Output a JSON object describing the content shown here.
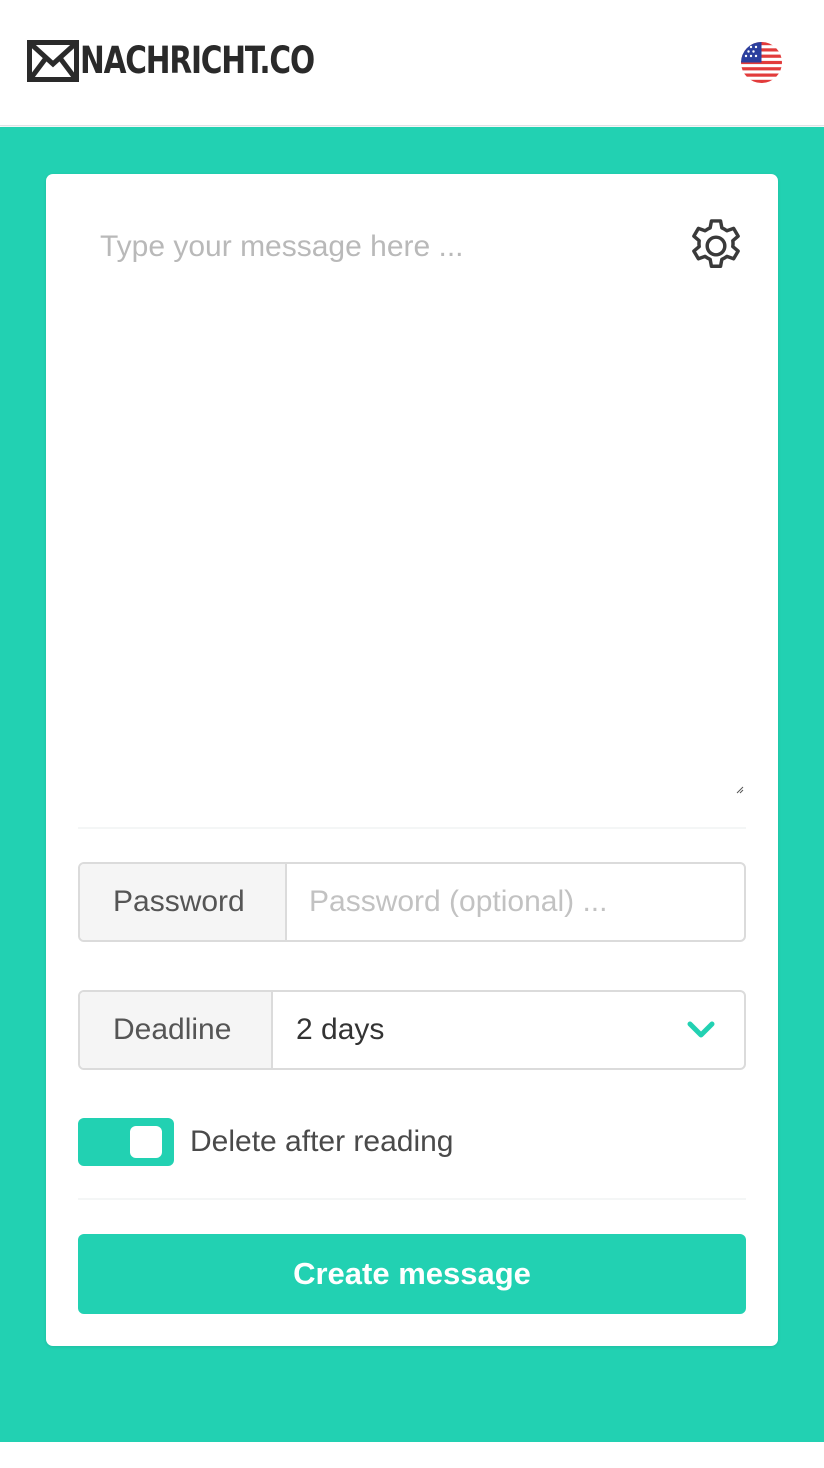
{
  "header": {
    "logo_text": "NACHRICHT.CO",
    "logo_icon": "envelope-icon",
    "language_icon": "us-flag-icon"
  },
  "composer": {
    "message_placeholder": "Type your message here ...",
    "message_value": "",
    "settings_icon": "gear-icon"
  },
  "password": {
    "label": "Password",
    "placeholder": "Password (optional) ...",
    "value": ""
  },
  "deadline": {
    "label": "Deadline",
    "selected": "2 days"
  },
  "delete_after_reading": {
    "label": "Delete after reading",
    "enabled": true
  },
  "create_button": {
    "label": "Create message"
  },
  "colors": {
    "accent": "#22d1b2",
    "text": "#4a4a4a",
    "placeholder": "#b9b9b9"
  }
}
